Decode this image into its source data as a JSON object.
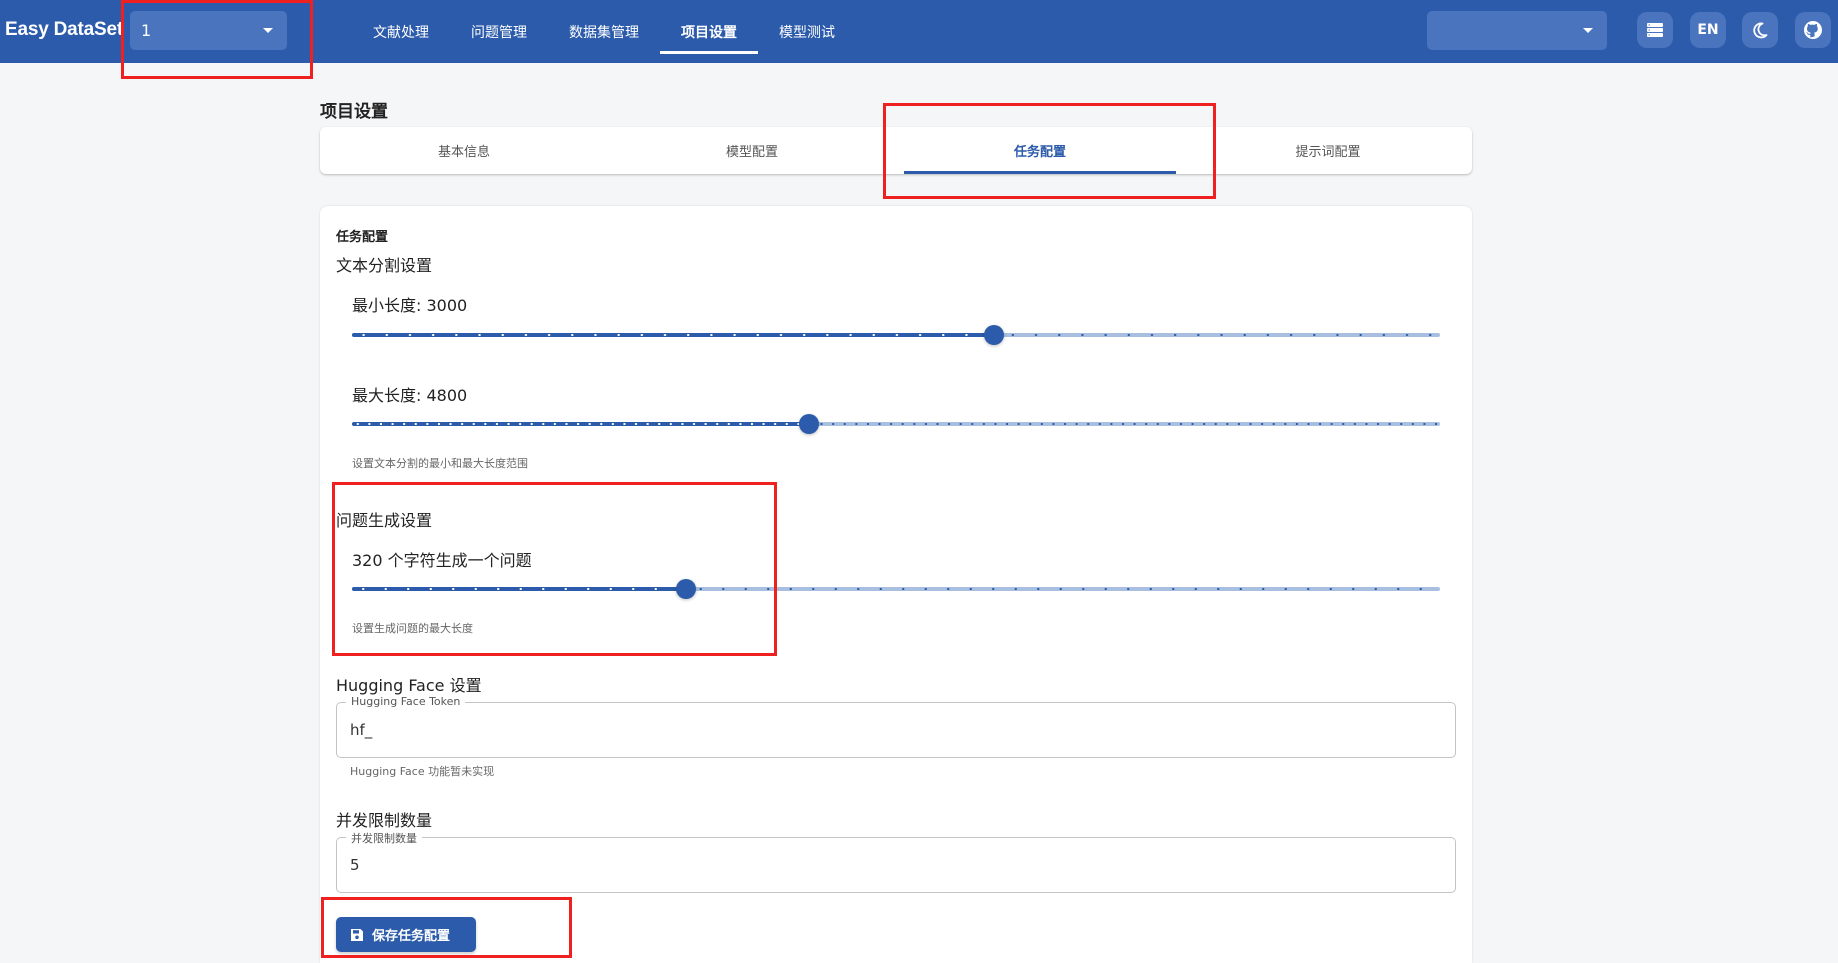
{
  "app": {
    "logo": "Easy DataSet"
  },
  "header": {
    "project_value": "1",
    "nav": [
      "文献处理",
      "问题管理",
      "数据集管理",
      "项目设置",
      "模型测试"
    ],
    "active_nav": 3,
    "model_value": "",
    "lang_label": "EN",
    "icons": [
      "list-icon",
      "language-toggle",
      "moon-icon",
      "github-icon"
    ]
  },
  "page": {
    "title": "项目设置",
    "tabs": [
      "基本信息",
      "模型配置",
      "任务配置",
      "提示词配置"
    ],
    "active_tab": 2
  },
  "task": {
    "card_title": "任务配置",
    "split": {
      "section": "文本分割设置",
      "min_label": "最小长度: 3000",
      "min_fraction": 0.59,
      "max_label": "最大长度: 4800",
      "max_fraction": 0.42,
      "helper": "设置文本分割的最小和最大长度范围"
    },
    "question": {
      "section": "问题生成设置",
      "label": "320 个字符生成一个问题",
      "fraction": 0.307,
      "helper": "设置生成问题的最大长度"
    },
    "hf": {
      "section": "Hugging Face 设置",
      "legend": "Hugging Face Token",
      "value": "hf_",
      "helper": "Hugging Face 功能暂未实现"
    },
    "concurrency": {
      "section": "并发限制数量",
      "legend": "并发限制数量",
      "value": "5"
    },
    "save_label": "保存任务配置"
  },
  "colors": {
    "primary": "#2b5baa",
    "annotation": "#ee2020"
  }
}
